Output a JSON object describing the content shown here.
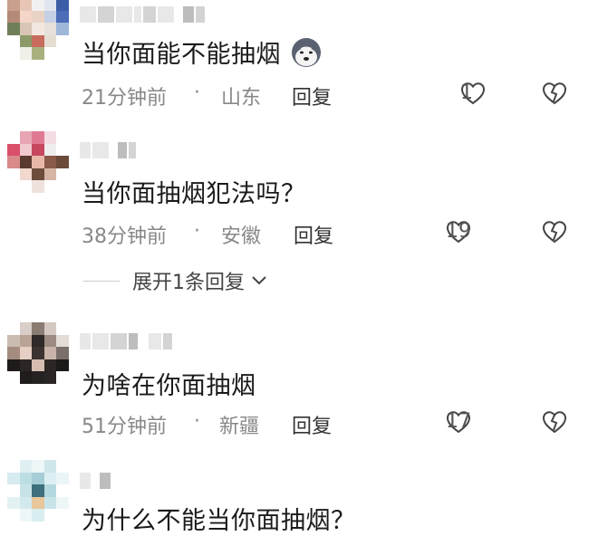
{
  "comments": [
    {
      "text": "当你面能不能抽烟",
      "emoji": "husky-dog-emoji",
      "time": "21分钟前",
      "location": "山东",
      "reply_label": "回复",
      "likes": "1"
    },
    {
      "text": "当你面抽烟犯法吗？",
      "time": "38分钟前",
      "location": "安徽",
      "reply_label": "回复",
      "likes": "19",
      "expand_label": "展开1条回复"
    },
    {
      "text": "为啥在你面抽烟",
      "time": "51分钟前",
      "location": "新疆",
      "reply_label": "回复",
      "likes": "17"
    },
    {
      "text": "为什么不能当你面抽烟？"
    }
  ],
  "separator": "·",
  "icons": {
    "like": "heart-outline-icon",
    "dislike": "broken-heart-icon",
    "expand": "chevron-down-icon"
  },
  "colors": {
    "meta_text": "#888888",
    "reply_text": "#333333",
    "body_text": "#1a1a1a"
  }
}
